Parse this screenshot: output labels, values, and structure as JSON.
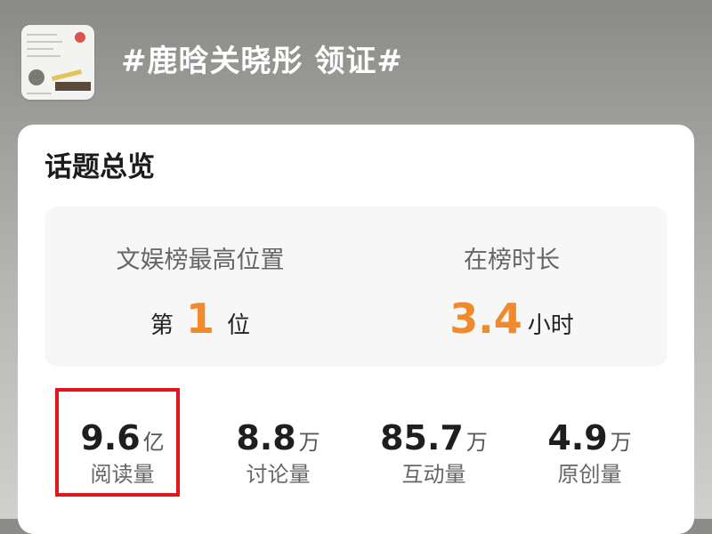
{
  "header": {
    "topic_title": "#鹿晗关晓彤 领证#",
    "thumbnail_icon": "topic-thumbnail-image"
  },
  "overview": {
    "title": "话题总览",
    "rank": {
      "label": "文娱榜最高位置",
      "prefix": "第",
      "value": "1",
      "suffix": "位"
    },
    "duration": {
      "label": "在榜时长",
      "value": "3.4",
      "unit": "小时"
    },
    "stats": [
      {
        "value": "9.6",
        "unit": "亿",
        "label": "阅读量"
      },
      {
        "value": "8.8",
        "unit": "万",
        "label": "讨论量"
      },
      {
        "value": "85.7",
        "unit": "万",
        "label": "互动量"
      },
      {
        "value": "4.9",
        "unit": "万",
        "label": "原创量"
      }
    ]
  },
  "colors": {
    "accent": "#ef8a2d",
    "highlight": "#e3141c"
  }
}
